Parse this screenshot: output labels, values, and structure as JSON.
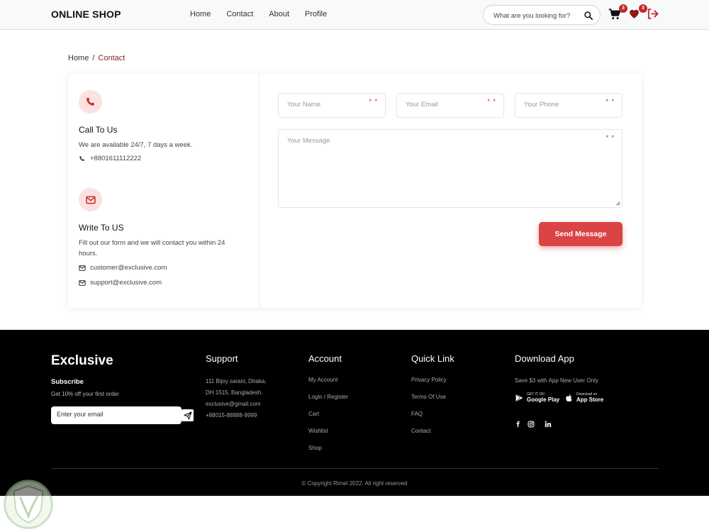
{
  "header": {
    "logo": "ONLINE SHOP",
    "nav": [
      "Home",
      "Contact",
      "About",
      "Profile"
    ],
    "search_placeholder": "What are you looking for?",
    "cart_count": "3",
    "wishlist_count": "3"
  },
  "breadcrumb": {
    "home": "Home",
    "separator": "/",
    "current": "Contact"
  },
  "contact": {
    "call": {
      "title": "Call To Us",
      "text": "We are available 24/7, 7 days a week.",
      "phone": "+8801611112222"
    },
    "write": {
      "title": "Write To US",
      "text": "Fill out our form and we will contact you within 24 hours.",
      "emails": [
        "customer@exclusive.com",
        "support@exclusive.com"
      ]
    }
  },
  "form": {
    "name_placeholder": "Your Name",
    "email_placeholder": "Your Email",
    "phone_placeholder": "Your Phone",
    "message_placeholder": "Your Message",
    "required_mark": "* *",
    "send_label": "Send Message"
  },
  "footer": {
    "brand": "Exclusive",
    "subscribe_title": "Subscribe",
    "subscribe_note": "Get 10% off your first order",
    "email_placeholder": "Enter your email",
    "support": {
      "title": "Support",
      "lines": [
        "111 Bijoy sarani, Dhaka,",
        "DH 1515, Bangladesh.",
        "exclusive@gmail.com",
        "+88015-88888-9999"
      ]
    },
    "account": {
      "title": "Account",
      "links": [
        "My Account",
        "Login / Register",
        "Cart",
        "Wishlist",
        "Shop"
      ]
    },
    "quick": {
      "title": "Quick Link",
      "links": [
        "Privacy Policy",
        "Terms Of Use",
        "FAQ",
        "Contact"
      ]
    },
    "app": {
      "title": "Download App",
      "note": "Save $3 with App New User Only",
      "google_small": "GET IT ON",
      "google_big": "Google Play",
      "apple_small": "Download on",
      "apple_big": "App Store"
    },
    "copyright": "© Copyright Rimel 2022. All right reserved"
  },
  "colors": {
    "accent": "#db4444",
    "link_current": "#8b1a1a",
    "footer_bg": "#000000"
  }
}
